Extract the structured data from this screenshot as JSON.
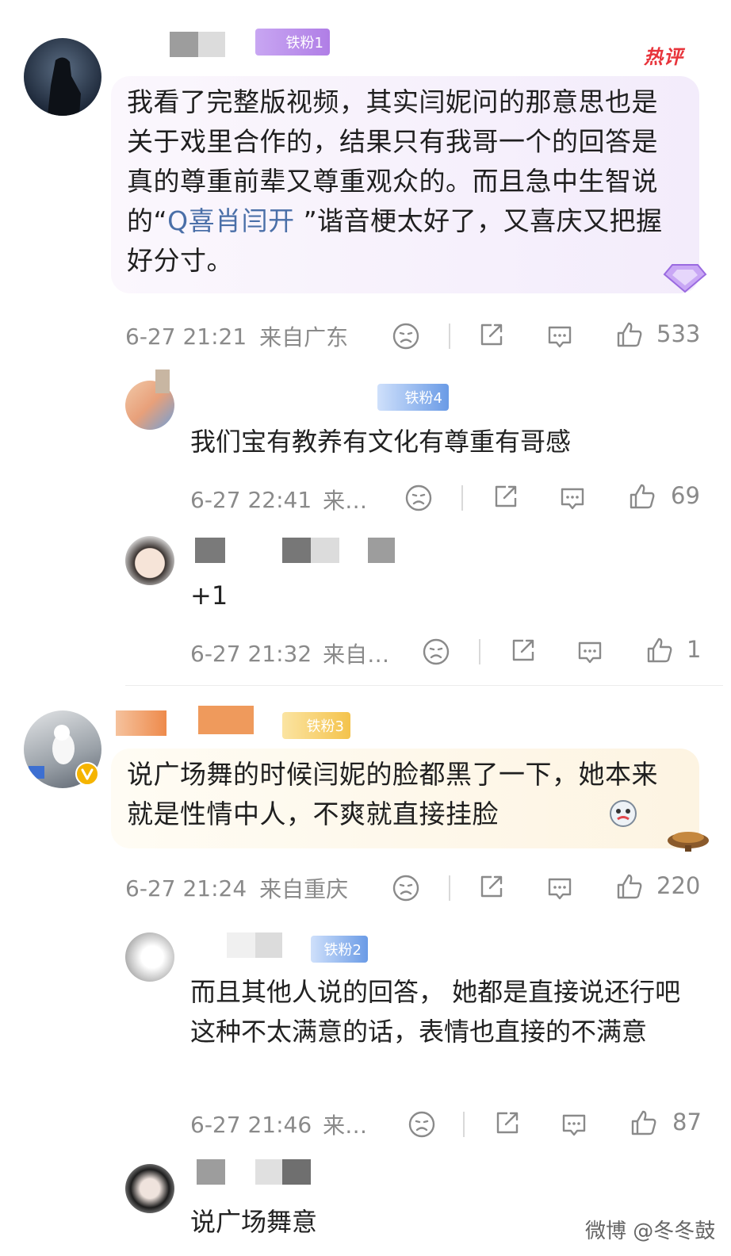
{
  "colors": {
    "accent": "#e8343b",
    "link": "#4a6fa8",
    "meta": "#8a8a8a"
  },
  "comments": [
    {
      "badge": "铁粉1",
      "hot_label": "热评",
      "text_parts": [
        "我看了完整版视频，其实闫妮问的那意思也是关于戏里合作的，结果只有我哥一个的回答是真的尊重前辈又尊重观众的。而且急中生智说的“",
        "Q喜肖闫开",
        " ”谐音梗太好了，又喜庆又把握好分寸。"
      ],
      "time": "6-27 21:21",
      "location": "来自广东",
      "likes": "533",
      "replies": [
        {
          "badge": "铁粉4",
          "text": "我们宝有教养有文化有尊重有哥感",
          "time": "6-27 22:41",
          "location": "来…",
          "likes": "69"
        },
        {
          "text": "+1",
          "time": "6-27 21:32",
          "location": "来自…",
          "likes": "1"
        }
      ]
    },
    {
      "badge": "铁粉3",
      "text": "说广场舞的时候闫妮的脸都黑了一下，她本来就是性情中人，不爽就直接挂脸",
      "time": "6-27 21:24",
      "location": "来自重庆",
      "likes": "220",
      "replies": [
        {
          "badge": "铁粉2",
          "text": "而且其他人说的回答， 她都是直接说还行吧这种不太满意的话，表情也直接的不满意",
          "time": "6-27 21:46",
          "location": "来…",
          "likes": "87"
        },
        {
          "text": "说广场舞意"
        }
      ]
    }
  ],
  "watermark": "微博 @冬冬鼓",
  "icons": [
    "sad-face-icon",
    "share-icon",
    "comment-icon",
    "thumbs-up-icon",
    "verified-v-icon",
    "diamond-badge-icon"
  ]
}
